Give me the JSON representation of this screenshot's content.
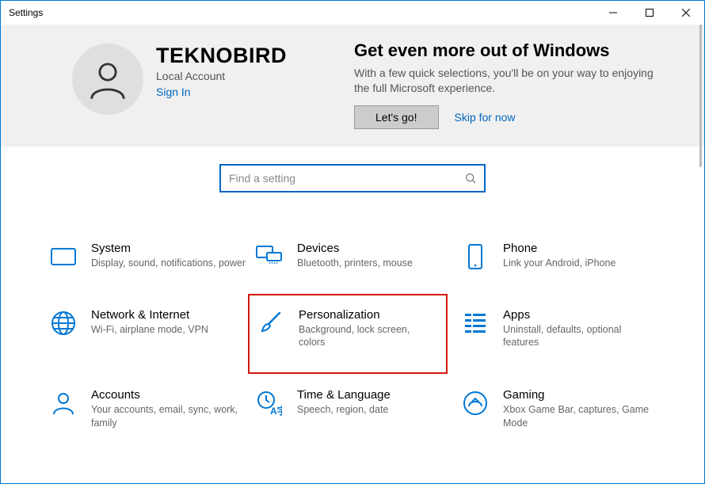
{
  "window": {
    "title": "Settings"
  },
  "account": {
    "name": "TEKNOBIRD",
    "subtitle": "Local Account",
    "sign_in": "Sign In"
  },
  "promo": {
    "title": "Get even more out of Windows",
    "desc": "With a few quick selections, you'll be on your way to enjoying the full Microsoft experience.",
    "primary": "Let's go!",
    "skip": "Skip for now"
  },
  "search": {
    "placeholder": "Find a setting"
  },
  "categories": [
    {
      "key": "system",
      "title": "System",
      "desc": "Display, sound, notifications, power"
    },
    {
      "key": "devices",
      "title": "Devices",
      "desc": "Bluetooth, printers, mouse"
    },
    {
      "key": "phone",
      "title": "Phone",
      "desc": "Link your Android, iPhone"
    },
    {
      "key": "network",
      "title": "Network & Internet",
      "desc": "Wi-Fi, airplane mode, VPN"
    },
    {
      "key": "personalization",
      "title": "Personalization",
      "desc": "Background, lock screen, colors",
      "highlighted": true
    },
    {
      "key": "apps",
      "title": "Apps",
      "desc": "Uninstall, defaults, optional features"
    },
    {
      "key": "accounts",
      "title": "Accounts",
      "desc": "Your accounts, email, sync, work, family"
    },
    {
      "key": "time",
      "title": "Time & Language",
      "desc": "Speech, region, date"
    },
    {
      "key": "gaming",
      "title": "Gaming",
      "desc": "Xbox Game Bar, captures, Game Mode"
    }
  ]
}
